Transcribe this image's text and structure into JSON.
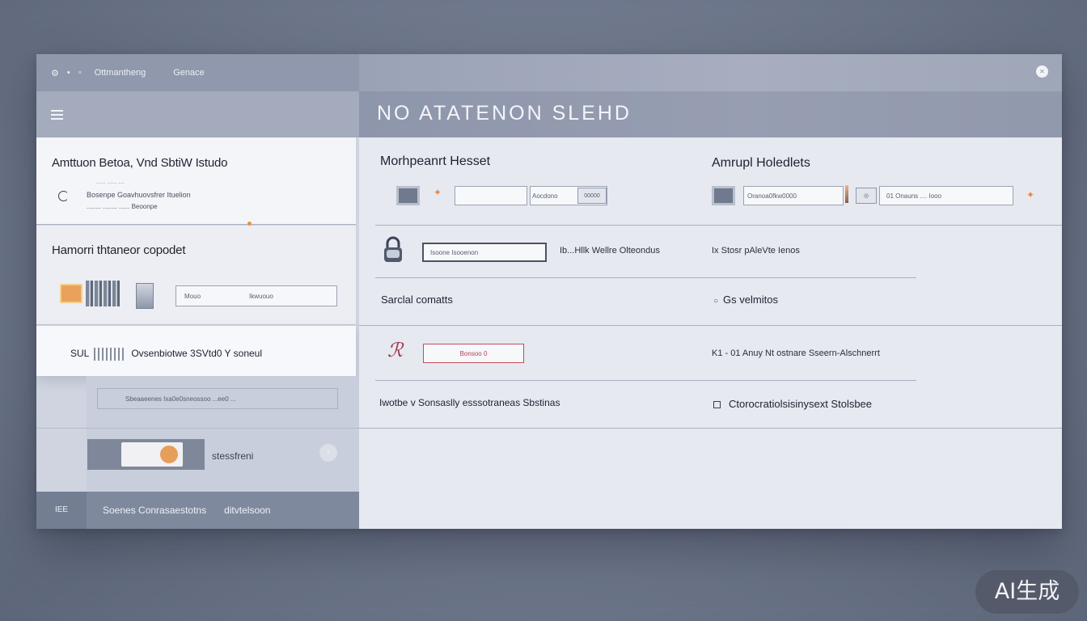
{
  "left_panel": {
    "top_bar": {
      "icon1": "settings-icon",
      "icon2": "pin-icon",
      "icon3": "menu-dot-icon",
      "label1": "Ottmantheng",
      "label2": "Genace"
    },
    "card1": {
      "title": "Amttuon Betoa, Vnd SbtiW Istudo",
      "sub_top": "...... ...... ....",
      "line1": "Bosenpe Goavhuovsfrer Ituelion",
      "line2": "........ ........ ...... Beoonpe"
    },
    "card2": {
      "title": "Hamorri thtaneor copodet",
      "input_left": "Mouo",
      "input_right": "Ikwuouo"
    },
    "card3": {
      "prefix": "SUL",
      "text": "Ovsenbiotwe 3SVtd0 Y soneul"
    },
    "lower_input": "Sbeaaeenes Ixa0e0sneossoo ...ee0 ...",
    "lower_label": "stessfreni",
    "footer": {
      "item0": "IEE",
      "item1": "Soenes Conrasaestotns",
      "item2": "ditvtelsoon"
    }
  },
  "right_panel": {
    "header_title": "NO ATATENON SLEHD",
    "close_icon": "close-icon",
    "col1_title": "Morhpeanrt Hesset",
    "col2_title": "Amrupl Holedlets",
    "row1": {
      "input1": "",
      "input2": "Aocdono",
      "mini_btn": "00000",
      "input3": "Oranoa0fkw0000",
      "input4": "01 Onauns .... Iooo"
    },
    "row2": {
      "input": "Isoone       Isooenon",
      "text_mid": "Ib...Hllk Wellre Olteondus",
      "text_right": "Ix  Stosr  pAleVte Ienos"
    },
    "row3": {
      "left": "Sarclal comatts",
      "right": "Gs velmitos"
    },
    "row4": {
      "input": "Bonsoo  0",
      "text_right": "K1 - 01 Anuy Nt ostnare Sseern-Alschnerrt"
    },
    "row5": {
      "left": "Iwotbe v Sonsaslly esssotraneas Sbstinas",
      "right": "Ctorocratiolsisinysext Stolsbee"
    }
  },
  "watermark": "AI生成"
}
